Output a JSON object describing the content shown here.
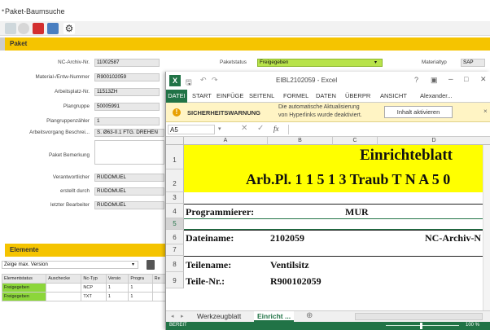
{
  "app": {
    "title": "Paket-Baumsuche",
    "section_paket": "Paket",
    "section_elemente": "Elemente",
    "accent": "#f5c400"
  },
  "form": {
    "nc_label": "NC-Archiv-Nr.",
    "nc_value": "11002587",
    "material_label": "Material-/Entw-Nummer",
    "material_value": "R900102059",
    "arbeitsplatz_label": "Arbeitsplatz-Nr.",
    "arbeitsplatz_value": "11513ZH",
    "plangruppe_label": "Plangruppe",
    "plangruppe_value": "50005991",
    "plangruppenzaehler_label": "Plangruppenzähler",
    "plangruppenzaehler_value": "1",
    "arbeitsvorgang_label": "Arbeitsvorgang Beschrei...",
    "arbeitsvorgang_value": "S. Ø63-0.1 FTG. DREHEN",
    "bemerkung_label": "Paket Bemerkung",
    "verantwortlicher_label": "Verantwortlicher",
    "verantwortlicher_value": "RUDOMUEL",
    "erstellt_label": "erstellt durch",
    "erstellt_value": "RUDOMUEL",
    "letzter_label": "letzter Bearbeiter",
    "letzter_value": "RUDOMUEL",
    "paketstatus_label": "Paketstatus",
    "paketstatus_value": "Freigegeben",
    "materialtyp_label": "Materialtyp",
    "materialtyp_value": "SAP"
  },
  "elements": {
    "version_select": "Zeige max. Version",
    "headers": [
      "Elementstatus",
      "Auschecke",
      "Nc-Typ",
      "Versio",
      "Progra",
      "Re"
    ],
    "rows": [
      [
        "Freigegeben",
        "",
        "NCP",
        "1",
        "1"
      ],
      [
        "Freigegeben",
        "",
        "TXT",
        "1",
        "1"
      ]
    ]
  },
  "excel": {
    "filename": "EIBL2102059 - Excel",
    "tabs": [
      "DATEI",
      "START",
      "EINFÜGE",
      "SEITENL",
      "FORMEL",
      "DATEN",
      "ÜBERPR",
      "ANSICHT",
      "Alexander..."
    ],
    "warning_title": "SICHERHEITSWARNUNG",
    "warning_text_1": "Die automatische Aktualisierung",
    "warning_text_2": "von Hyperlinks wurde deaktiviert.",
    "warning_button": "Inhalt aktivieren",
    "name_box": "A5",
    "fx": "fx",
    "columns": [
      "A",
      "B",
      "C",
      "D"
    ],
    "row_numbers": [
      "1",
      "2",
      "3",
      "4",
      "5",
      "6",
      "7",
      "8",
      "9"
    ],
    "cells": {
      "r1": "Einrichteblatt",
      "r2": "Arb.Pl.  1 1 5 1 3   Traub T N A 5 0",
      "r4a": "Programmierer:",
      "r4c": "MUR",
      "r6a": "Dateiname:",
      "r6b": "2102059",
      "r6d": "NC-Archiv-N",
      "r8a": "Teilename:",
      "r8b": "Ventilsitz",
      "r9a": "Teile-Nr.:",
      "r9b": "R900102059"
    },
    "sheet_tabs": [
      "Werkzeugblatt",
      "Einricht ..."
    ],
    "status_left": "BEREIT",
    "zoom": "100 %",
    "green": "#217346"
  }
}
